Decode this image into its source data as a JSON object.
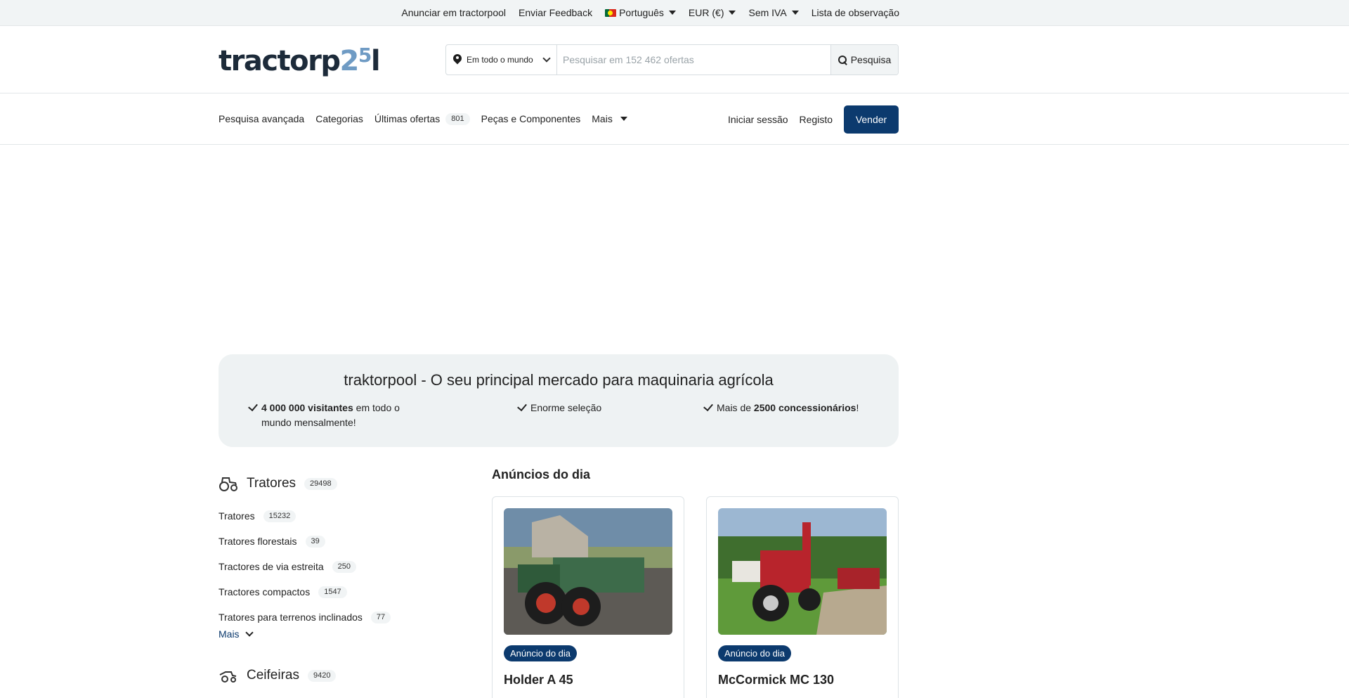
{
  "topbar": {
    "advertise": "Anunciar em tractorpool",
    "feedback": "Enviar Feedback",
    "language": "Português",
    "currency": "EUR (€)",
    "vat": "Sem IVA",
    "watchlist": "Lista de observação"
  },
  "header": {
    "logo_main": "tractorp",
    "logo_accent": "2",
    "logo_sup": "5",
    "logo_end": "l",
    "location": "Em todo o mundo",
    "search_placeholder": "Pesquisar em 152 462 ofertas",
    "search_button": "Pesquisa"
  },
  "nav": {
    "advanced_search": "Pesquisa avançada",
    "categories": "Categorias",
    "latest_offers": "Últimas ofertas",
    "latest_offers_count": "801",
    "parts": "Peças e Componentes",
    "more": "Mais",
    "login": "Iniciar sessão",
    "register": "Registo",
    "sell": "Vender"
  },
  "hero": {
    "title": "traktorpool - O seu principal mercado para maquinaria agrícola",
    "feature1_bold": "4 000 000 visitantes",
    "feature1_rest": " em todo o mundo mensalmente!",
    "feature2": "Enorme seleção",
    "feature3_pre": "Mais de ",
    "feature3_bold": "2500 concessionários",
    "feature3_post": "!"
  },
  "categories": {
    "main_title": "Tratores",
    "main_count": "29498",
    "items": [
      {
        "label": "Tratores",
        "count": "15232"
      },
      {
        "label": "Tratores florestais",
        "count": "39"
      },
      {
        "label": "Tractores de via estreita",
        "count": "250"
      },
      {
        "label": "Tractores compactos",
        "count": "1547"
      },
      {
        "label": "Tratores para terrenos inclinados",
        "count": "77"
      }
    ],
    "more": "Mais",
    "second_title": "Ceifeiras",
    "second_count": "9420"
  },
  "daily": {
    "title": "Anúncios do dia",
    "cards": [
      {
        "badge": "Anúncio do dia",
        "title": "Holder A 45"
      },
      {
        "badge": "Anúncio do dia",
        "title": "McCormick MC 130"
      }
    ]
  },
  "colors": {
    "primary": "#0c3a6e",
    "topbar_bg": "#f1f4f5",
    "logo_accent": "#6f9bc4"
  }
}
